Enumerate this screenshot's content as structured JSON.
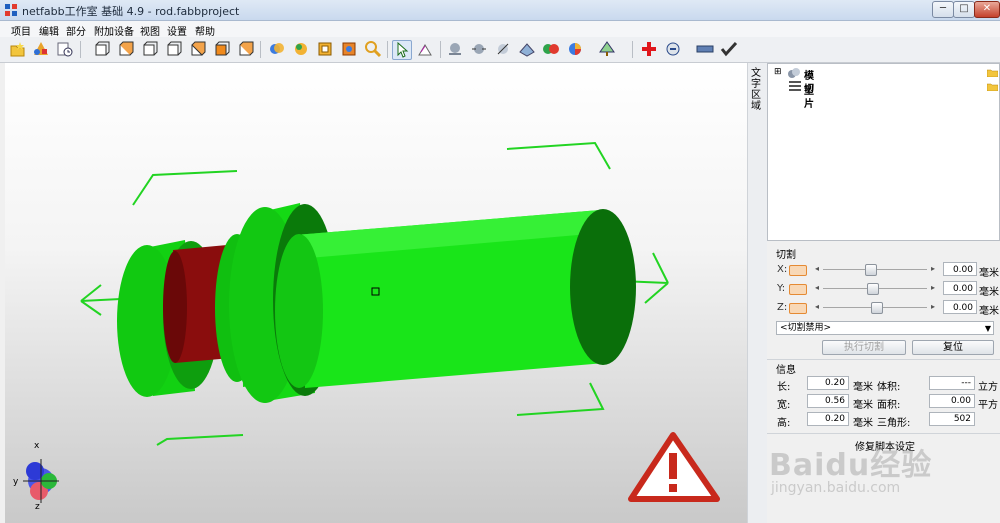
{
  "window": {
    "title": "netfabb工作室 基础 4.9 - rod.fabbproject",
    "minimize": "─",
    "maximize": "□",
    "close": "✕"
  },
  "menu": [
    "项目",
    "编辑",
    "部分",
    "附加设备",
    "视图",
    "设置",
    "帮助"
  ],
  "toolbar": {
    "icons": [
      "new-project-icon",
      "add-part-icon",
      "measure-icon",
      "view-front-icon",
      "view-back-icon",
      "view-left-icon",
      "view-right-icon",
      "view-top-icon",
      "view-bottom-icon",
      "view-iso-icon",
      "rotate-icon",
      "color-icon",
      "box-icon",
      "snapshot-icon",
      "zoom-icon",
      "select-pointer-icon",
      "select-face-icon",
      "sphere-icon",
      "sphere-move-icon",
      "shading-icon",
      "texture-icon",
      "color-spheres-icon",
      "pie-menu-icon",
      "tree-menu-icon",
      "repair-red-cross-icon",
      "cut-menu-icon",
      "ruler-icon",
      "checkmark-icon"
    ]
  },
  "side_tab": "文字区域",
  "tree": {
    "items": [
      {
        "label": "模型",
        "icon": "models-icon"
      },
      {
        "label": "切片",
        "icon": "slices-icon"
      }
    ]
  },
  "cut": {
    "title": "切割",
    "unit": "毫米",
    "axes": [
      {
        "label": "X:",
        "value": "0.00",
        "slider": 0.5
      },
      {
        "label": "Y:",
        "value": "0.00",
        "slider": 0.52
      },
      {
        "label": "Z:",
        "value": "0.00",
        "slider": 0.56
      }
    ],
    "select_value": "<切割禁用>",
    "execute_button": "执行切割",
    "reset_button": "复位"
  },
  "info": {
    "title": "信息",
    "rows": [
      {
        "label": "长:",
        "value": "0.20",
        "unit": "毫米",
        "label2": "体积:",
        "value2": "---",
        "unit2": "立方"
      },
      {
        "label": "宽:",
        "value": "0.56",
        "unit": "毫米",
        "label2": "面积:",
        "value2": "0.00",
        "unit2": "平方"
      },
      {
        "label": "高:",
        "value": "0.20",
        "unit": "毫米",
        "label2": "三角形:",
        "value2": "502",
        "unit2": ""
      }
    ]
  },
  "bottom_text": "修复脚本设定",
  "axis_labels": {
    "x": "x",
    "y": "y",
    "z": "z"
  },
  "colors": {
    "model_green": "#14e014",
    "model_dark_green": "#0a6f0a",
    "model_red": "#8a0d0d",
    "gizmo_green": "#22d422",
    "warning_red": "#c8291c"
  },
  "watermark": {
    "brand": "Baidu经验",
    "url": "jingyan.baidu.com"
  }
}
